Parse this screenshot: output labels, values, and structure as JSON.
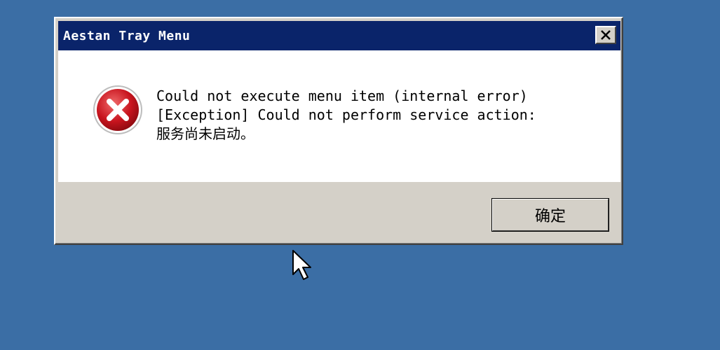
{
  "dialog": {
    "title": "Aestan Tray Menu",
    "close_icon": "close-icon",
    "icon": "error-icon",
    "message_lines": [
      "Could not execute menu item (internal error)",
      "[Exception] Could not perform service action:",
      "服务尚未启动。"
    ],
    "ok_label": "确定"
  },
  "colors": {
    "desktop": "#3b6ea5",
    "titlebar": "#0a246a",
    "dialog_face": "#d4d0c8",
    "error_red": "#c8141e"
  }
}
